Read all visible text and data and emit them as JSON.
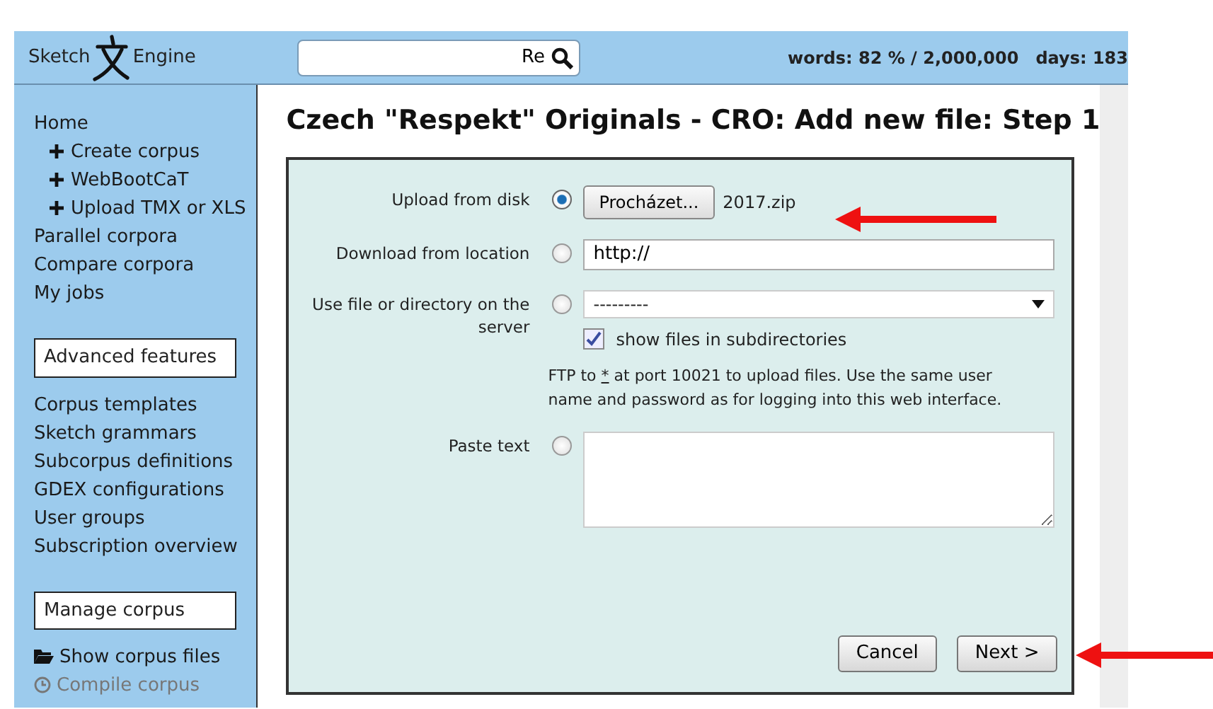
{
  "header": {
    "logo_left": "Sketch",
    "logo_right": "Engine",
    "search": {
      "value": "Re"
    },
    "usage": "words: 82 % / 2,000,000",
    "days": "days: 183"
  },
  "sidebar": {
    "items": [
      {
        "kind": "link",
        "label": "Home"
      },
      {
        "kind": "sub",
        "label": "Create corpus"
      },
      {
        "kind": "sub",
        "label": "WebBootCaT"
      },
      {
        "kind": "sub",
        "label": "Upload TMX or XLS"
      },
      {
        "kind": "link",
        "label": "Parallel corpora"
      },
      {
        "kind": "link",
        "label": "Compare corpora"
      },
      {
        "kind": "link",
        "label": "My jobs"
      },
      {
        "kind": "heading",
        "label": "Advanced features"
      },
      {
        "kind": "link",
        "label": "Corpus templates"
      },
      {
        "kind": "link",
        "label": "Sketch grammars"
      },
      {
        "kind": "link",
        "label": "Subcorpus definitions"
      },
      {
        "kind": "link",
        "label": "GDEX configurations"
      },
      {
        "kind": "link",
        "label": "User groups"
      },
      {
        "kind": "link",
        "label": "Subscription overview"
      },
      {
        "kind": "heading",
        "label": "Manage corpus"
      },
      {
        "kind": "folder",
        "label": "Show corpus files"
      },
      {
        "kind": "disabled",
        "label": "Compile corpus"
      }
    ]
  },
  "page_title": "Czech \"Respekt\" Originals - CRO: Add new file: Step 1",
  "form": {
    "options": [
      {
        "kind": "file",
        "label": "Upload from disk",
        "selected": true,
        "button": "Procházet...",
        "file_name": "2017.zip"
      },
      {
        "kind": "url",
        "label": "Download from location",
        "selected": false,
        "value": "http://"
      },
      {
        "kind": "server",
        "label": "Use file or directory on the server",
        "selected": false,
        "value": "---------",
        "checkbox": {
          "label": "show files in subdirectories",
          "checked": true
        },
        "note_before": "FTP to ",
        "note_link": "*",
        "note_after": " at port 10021 to upload files. Use the same user name and password as for logging into this web interface."
      },
      {
        "kind": "text",
        "label": "Paste text",
        "selected": false
      }
    ],
    "buttons": [
      "Cancel",
      "Next >"
    ]
  },
  "annotations": [
    {
      "kind": "arrow"
    },
    {
      "kind": "arrow"
    }
  ]
}
